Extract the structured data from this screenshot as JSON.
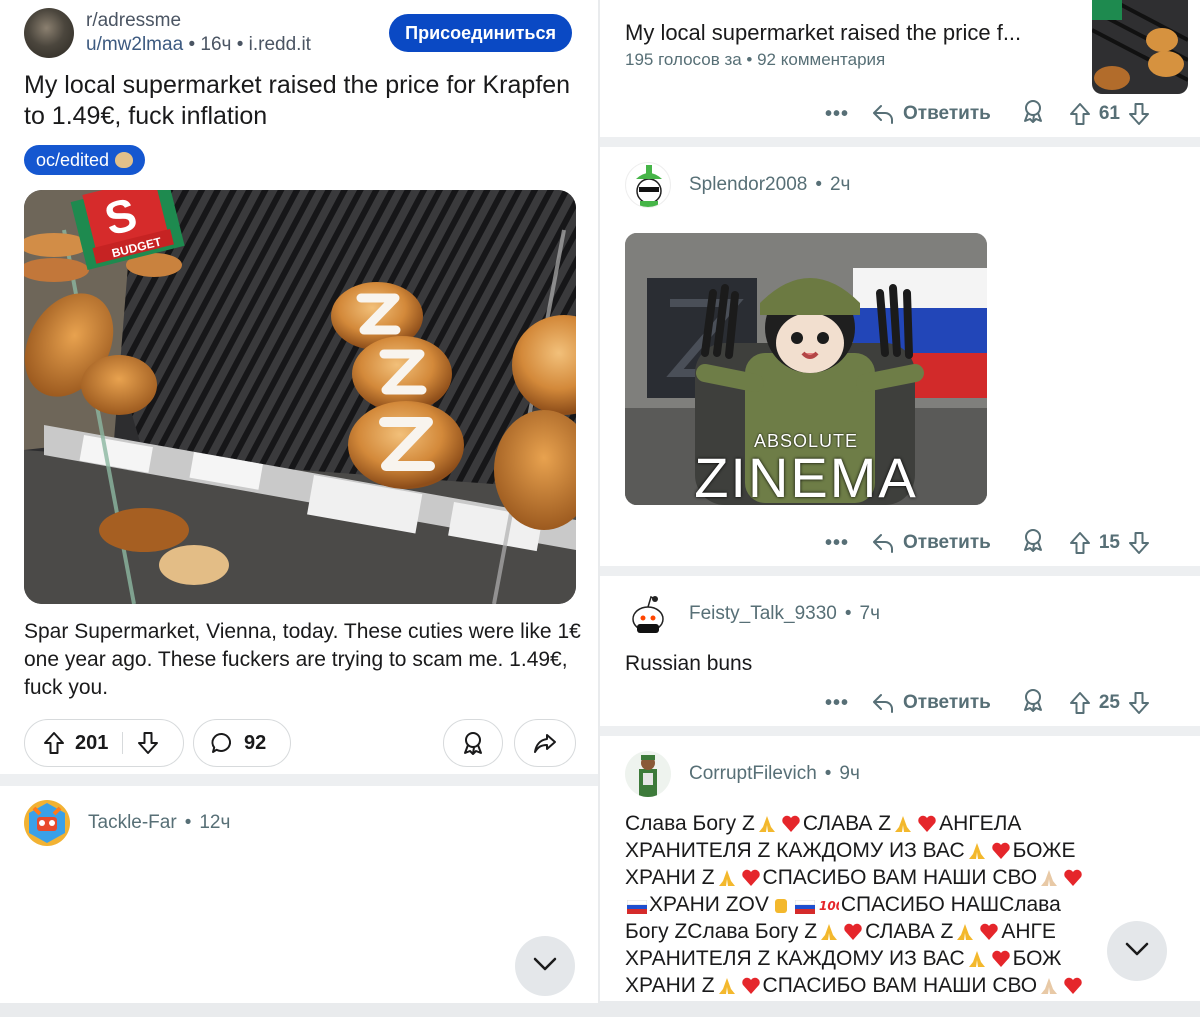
{
  "left": {
    "post": {
      "subreddit": "r/adressme",
      "user": "u/mw2lmaa",
      "age": "16ч",
      "domain": "i.redd.it",
      "join_label": "Присоединиться",
      "title": "My local supermarket raised the price for Krapfen to 1.49€, fuck inflation",
      "flair": "oc/edited",
      "image_sign": "S",
      "image_sign_label": "BUDGET",
      "description": "Spar Supermarket, Vienna, today. These cuties were like 1€ one year ago. These fuckers are trying to scam me. 1.49€, fuck you.",
      "upvotes": "201",
      "comments": "92"
    },
    "comment": {
      "author": "Tackle-Far",
      "age": "12ч"
    }
  },
  "right": {
    "header": {
      "title": "My local supermarket raised the price f...",
      "stats": "195 голосов за • 92 комментария"
    },
    "actions": {
      "reply_label": "Ответить",
      "more": "•••"
    },
    "comments": [
      {
        "author": "",
        "score": "61"
      },
      {
        "author": "Splendor2008",
        "age": "2ч",
        "image_top": "ABSOLUTE",
        "image_bottom": "ZINEMA",
        "score": "15"
      },
      {
        "author": "Feisty_Talk_9330",
        "age": "7ч",
        "text": "Russian buns",
        "score": "25"
      },
      {
        "author": "CorruptFilevich",
        "age": "9ч",
        "lines": [
          "Слава Богу Z",
          "СЛАВА Z",
          "АНГЕЛА",
          "ХРАНИТЕЛЯ Z КАЖДОМУ ИЗ ВАС",
          "БОЖЕ",
          "ХРАНИ Z",
          "СПАСИБО ВАМ НАШИ СВО",
          "ХРАНИ ZOV",
          "СПАСИБО НАШСлава",
          "Богу ZСлава Богу Z",
          "СЛАВА Z",
          "АНГЕ",
          "ХРАНИТЕЛЯ Z КАЖДОМУ ИЗ ВАС",
          "БОЖ",
          "ХРАНИ Z",
          "СПАСИБО ВАМ НАШИ СВО"
        ]
      }
    ]
  },
  "colors": {
    "join": "#0a49c4",
    "flair": "#1557d0",
    "muted": "#576f76"
  }
}
